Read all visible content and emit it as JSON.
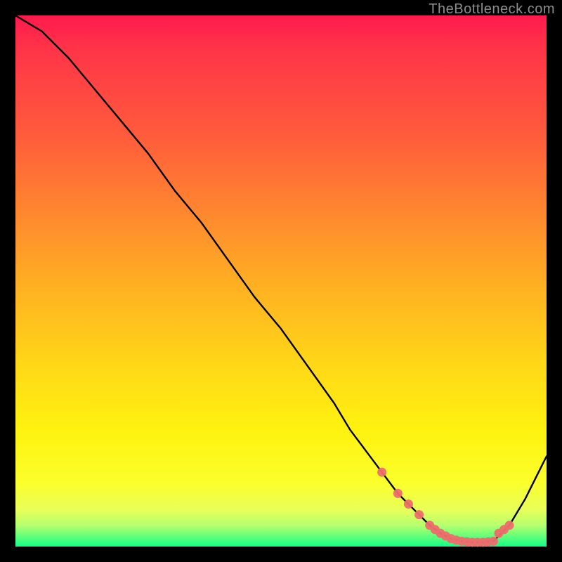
{
  "watermark": "TheBottleneck.com",
  "chart_data": {
    "type": "line",
    "title": "",
    "xlabel": "",
    "ylabel": "",
    "xlim": [
      0,
      100
    ],
    "ylim": [
      0,
      100
    ],
    "grid": false,
    "legend": false,
    "background_gradient": {
      "direction": "vertical",
      "stops": [
        {
          "pos": 0.0,
          "color": "#ff1a4d"
        },
        {
          "pos": 0.22,
          "color": "#ff5a3c"
        },
        {
          "pos": 0.52,
          "color": "#ffb321"
        },
        {
          "pos": 0.78,
          "color": "#fff20f"
        },
        {
          "pos": 0.93,
          "color": "#e9ff58"
        },
        {
          "pos": 0.985,
          "color": "#50ff7d"
        },
        {
          "pos": 1.0,
          "color": "#10ff88"
        }
      ]
    },
    "series": [
      {
        "name": "bottleneck-curve",
        "color": "#000000",
        "style": "line",
        "x": [
          0,
          5,
          10,
          15,
          20,
          25,
          30,
          35,
          40,
          45,
          50,
          55,
          60,
          63,
          66,
          69,
          72,
          75,
          78,
          80,
          82,
          84,
          86,
          88,
          90,
          93,
          96,
          100
        ],
        "y": [
          100,
          97,
          92,
          86,
          80,
          74,
          67,
          61,
          54,
          47,
          41,
          34,
          27,
          22,
          18,
          14,
          10,
          7,
          4,
          2.5,
          1.5,
          1,
          0.8,
          0.8,
          1,
          4,
          9,
          17
        ]
      },
      {
        "name": "highlighted-bottom-markers",
        "color": "#ee6d6d",
        "style": "scatter",
        "x": [
          69,
          72,
          74,
          76,
          78,
          79,
          80,
          81,
          82,
          83,
          84,
          85,
          86,
          87,
          88,
          89,
          90,
          91,
          92,
          93
        ],
        "y": [
          14,
          10,
          8,
          6,
          4,
          3.2,
          2.5,
          2.0,
          1.5,
          1.2,
          1.0,
          0.9,
          0.8,
          0.8,
          0.8,
          0.9,
          1.0,
          2.5,
          3.2,
          4.0
        ]
      }
    ]
  }
}
